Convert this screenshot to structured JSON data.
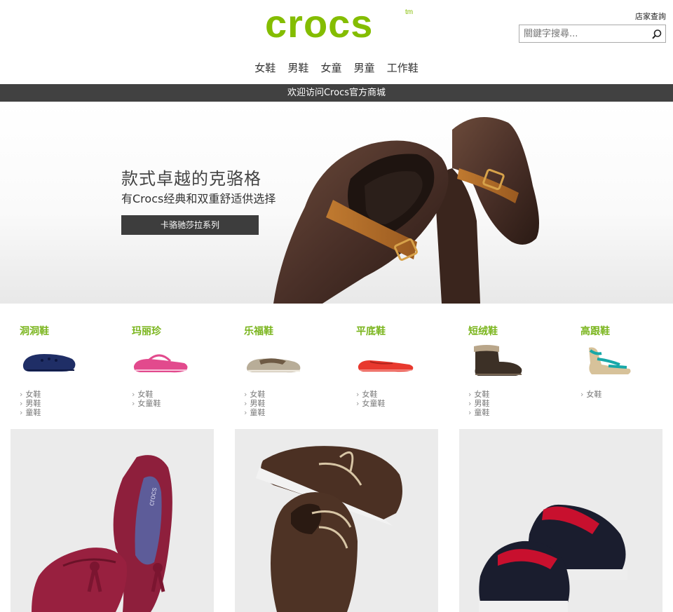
{
  "header": {
    "logo_text": "crocs",
    "logo_tm": "tm",
    "store_locator": "店家查詢",
    "search_placeholder": "關鍵字搜尋..."
  },
  "nav": {
    "items": [
      "女鞋",
      "男鞋",
      "女童",
      "男童",
      "工作鞋"
    ]
  },
  "welcome": "欢迎访问Crocs官方商城",
  "hero": {
    "title": "款式卓越的克骆格",
    "subtitle": "有Crocs经典和双重舒适供选择",
    "button_label": "卡骆驰莎拉系列"
  },
  "categories": [
    {
      "title": "洞洞鞋",
      "links": [
        "女鞋",
        "男鞋",
        "童鞋"
      ]
    },
    {
      "title": "玛丽珍",
      "links": [
        "女鞋",
        "女童鞋"
      ]
    },
    {
      "title": "乐福鞋",
      "links": [
        "女鞋",
        "男鞋",
        "童鞋"
      ]
    },
    {
      "title": "平底鞋",
      "links": [
        "女鞋",
        "女童鞋"
      ]
    },
    {
      "title": "短绒鞋",
      "links": [
        "女鞋",
        "男鞋",
        "童鞋"
      ]
    },
    {
      "title": "高跟鞋",
      "links": [
        "女鞋"
      ]
    }
  ],
  "colors": {
    "brand_green": "#84bd00",
    "category_green": "#7ab51d",
    "welcome_bar": "#414141"
  },
  "icons": {
    "search": "magnifier-icon",
    "arrow": "chevron-right-icon"
  }
}
